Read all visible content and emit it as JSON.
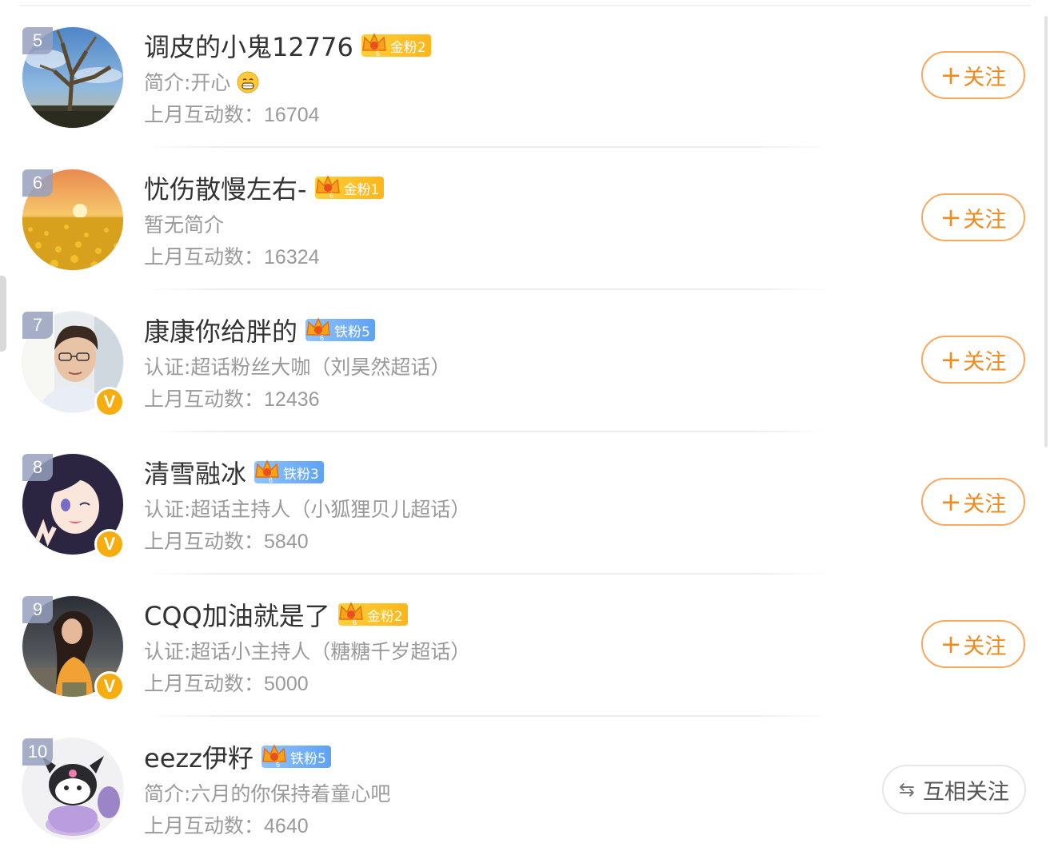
{
  "users": [
    {
      "rank": "5",
      "name": "调皮的小鬼12776",
      "badge": {
        "type": "gold",
        "label": "金粉2"
      },
      "description": "简介:开心",
      "emoji": "grin-emoji",
      "interaction_label": "上月互动数：",
      "interaction_value": "16704",
      "verified": false,
      "avatar": "tree-sky-photo",
      "action": "follow"
    },
    {
      "rank": "6",
      "name": "忧伤散慢左右-",
      "badge": {
        "type": "gold",
        "label": "金粉1"
      },
      "description": "暂无简介",
      "interaction_label": "上月互动数：",
      "interaction_value": "16324",
      "verified": false,
      "avatar": "sunset-field-photo",
      "action": "follow"
    },
    {
      "rank": "7",
      "name": "康康你给胖的",
      "badge": {
        "type": "iron",
        "label": "铁粉5"
      },
      "description": "认证:超话粉丝大咖（刘昊然超话）",
      "interaction_label": "上月互动数：",
      "interaction_value": "12436",
      "verified": true,
      "avatar": "portrait-photo",
      "action": "follow"
    },
    {
      "rank": "8",
      "name": "清雪融冰",
      "badge": {
        "type": "iron",
        "label": "铁粉3"
      },
      "description": "认证:超话主持人（小狐狸贝儿超话）",
      "interaction_label": "上月互动数：",
      "interaction_value": "5840",
      "verified": true,
      "avatar": "anime-girl-avatar",
      "action": "follow"
    },
    {
      "rank": "9",
      "name": "CQQ加油就是了",
      "badge": {
        "type": "gold",
        "label": "金粉2"
      },
      "description": "认证:超话小主持人（糖糖千岁超话）",
      "interaction_label": "上月互动数：",
      "interaction_value": "5000",
      "verified": true,
      "avatar": "beach-girl-photo",
      "action": "follow"
    },
    {
      "rank": "10",
      "name": "eezz伊籽",
      "badge": {
        "type": "iron",
        "label": "铁粉5"
      },
      "description": "简介:六月的你保持着童心吧",
      "interaction_label": "上月互动数：",
      "interaction_value": "4640",
      "verified": false,
      "avatar": "kuromi-toy-photo",
      "action": "mutual"
    }
  ],
  "buttons": {
    "follow_plus": "+",
    "follow_label": "关注",
    "mutual_icon": "⇆",
    "mutual_label": "互相关注"
  },
  "colors": {
    "accent_orange": "#f08a1c",
    "gold_badge": "#ffb61a",
    "iron_badge": "#5ea2f4",
    "verified": "#f5ad10",
    "text_secondary": "#9a9a9a"
  }
}
